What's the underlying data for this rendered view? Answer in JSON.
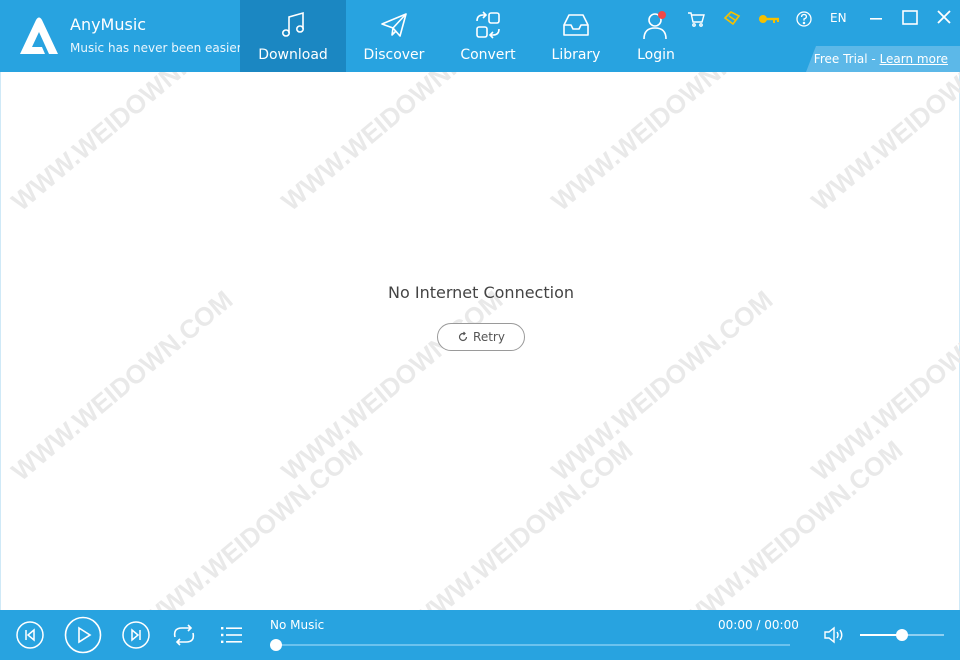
{
  "app": {
    "name": "AnyMusic",
    "tagline": "Music has never been easier"
  },
  "nav": {
    "tabs": [
      {
        "label": "Download",
        "icon": "music-note-icon",
        "active": true
      },
      {
        "label": "Discover",
        "icon": "paper-plane-icon",
        "active": false
      },
      {
        "label": "Convert",
        "icon": "convert-icon",
        "active": false
      },
      {
        "label": "Library",
        "icon": "inbox-tray-icon",
        "active": false
      },
      {
        "label": "Login",
        "icon": "user-icon",
        "active": false
      }
    ]
  },
  "top_icons": [
    "cart-icon",
    "gift-icon",
    "key-icon",
    "help-icon"
  ],
  "language": "EN",
  "trial": {
    "text": "Free Trial - ",
    "link": "Learn more"
  },
  "main": {
    "message": "No Internet Connection",
    "retry_label": "Retry"
  },
  "player": {
    "track": "No Music",
    "time": "00:00 / 00:00",
    "progress": 0,
    "volume": 0.5
  },
  "colors": {
    "accent": "#28a3e0",
    "active_tab": "#1b87c2",
    "notification_dot": "#f04848",
    "gold_icons": "#f5c000"
  }
}
